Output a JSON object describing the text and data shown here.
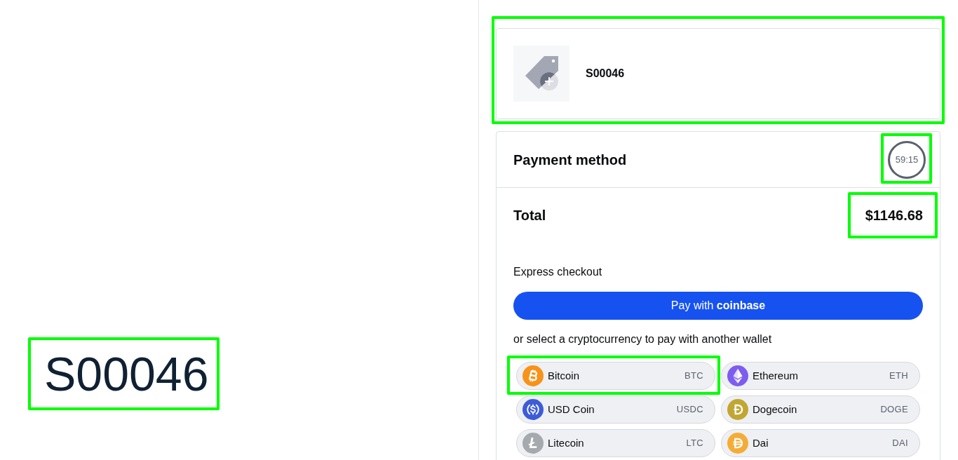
{
  "order_heading": {
    "text": "S00046",
    "highlighted": true
  },
  "product": {
    "name": "S00046",
    "highlighted": true
  },
  "payment": {
    "title": "Payment method",
    "timer": {
      "text": "59:15",
      "highlighted": true
    },
    "total": {
      "label": "Total",
      "amount": "$1146.68",
      "highlighted": true
    },
    "express_label": "Express checkout",
    "pay_button": "Pay with **coinbase**",
    "wallet_prompt": "or select a cryptocurrency to pay with another wallet",
    "currencies": [
      {
        "name": "Bitcoin",
        "code": "BTC",
        "highlighted": true
      },
      {
        "name": "Ethereum",
        "code": "ETH",
        "highlighted": false
      },
      {
        "name": "USD Coin",
        "code": "USDC",
        "highlighted": false
      },
      {
        "name": "Dogecoin",
        "code": "DOGE",
        "highlighted": false
      },
      {
        "name": "Litecoin",
        "code": "LTC",
        "highlighted": false
      },
      {
        "name": "Dai",
        "code": "DAI",
        "highlighted": false
      }
    ]
  }
}
